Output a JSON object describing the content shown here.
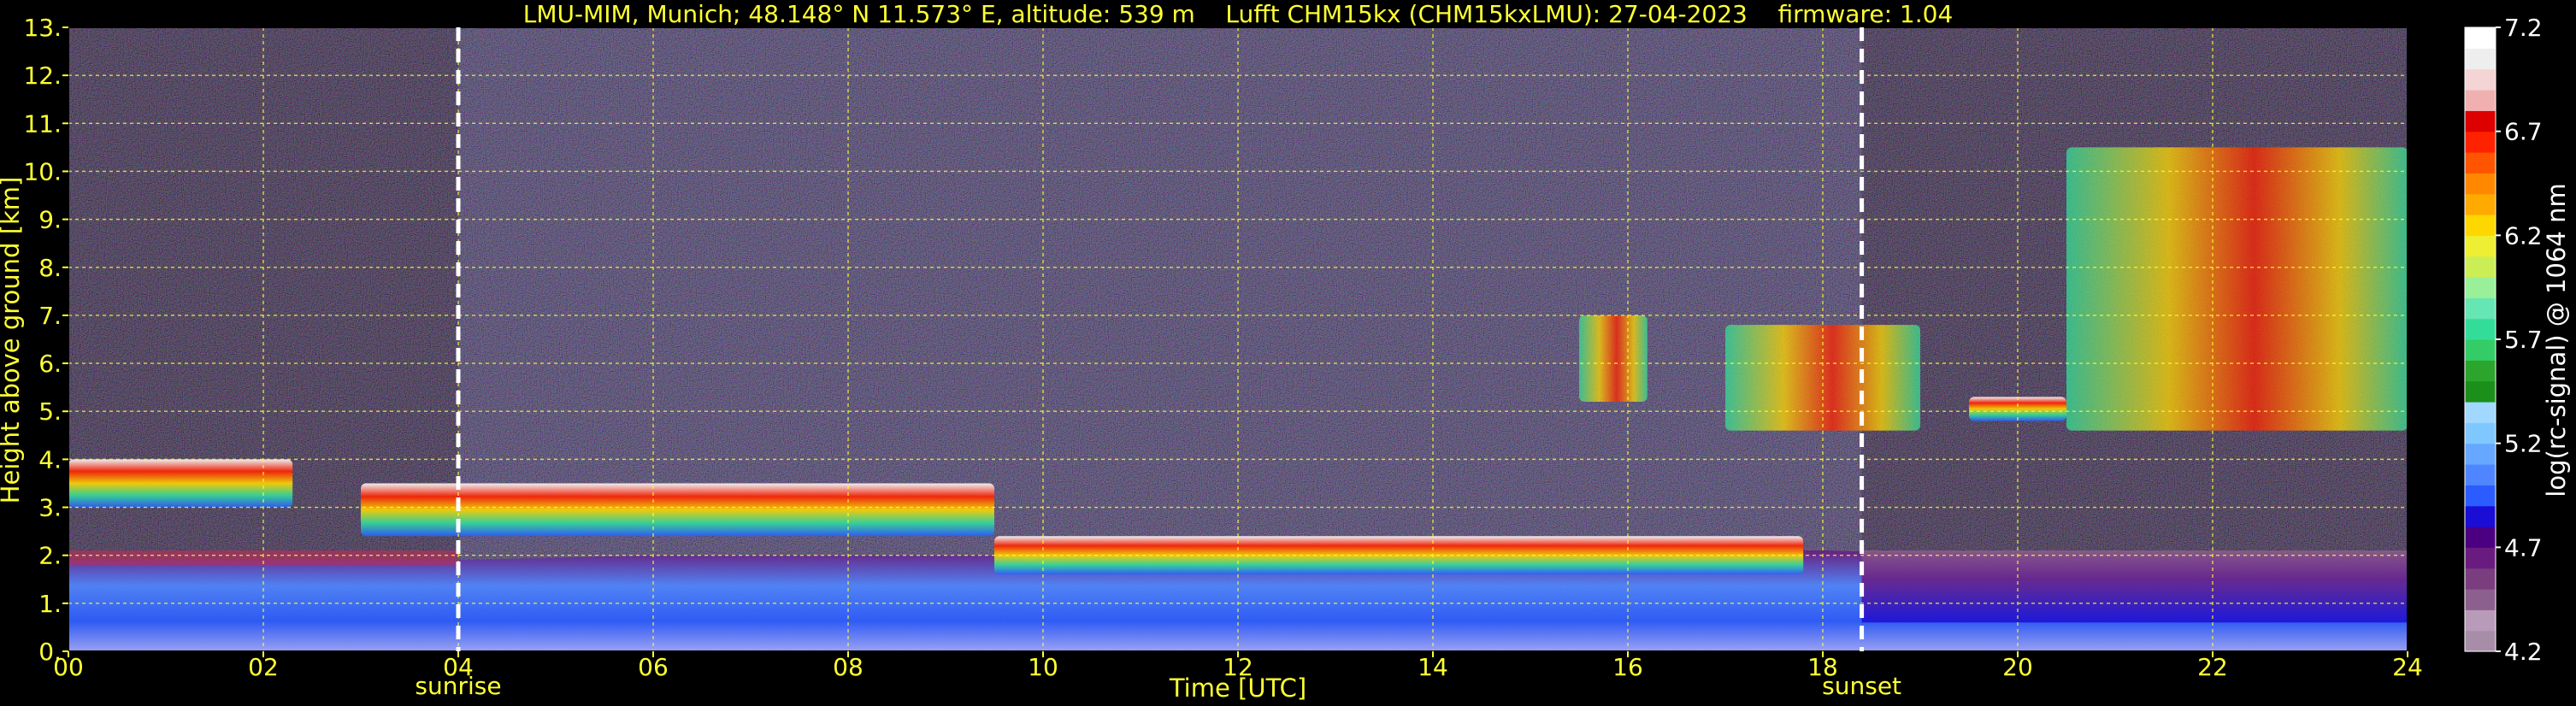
{
  "chart_data": {
    "type": "heatmap",
    "title": "LMU-MIM, Munich; 48.148° N 11.573° E, altitude: 539 m    Lufft CHM15kx (CHM15kxLMU): 27-04-2023    firmware: 1.04",
    "xlabel": "Time [UTC]",
    "ylabel": "Height above ground [km]",
    "xlim": [
      0,
      24
    ],
    "ylim": [
      0,
      13
    ],
    "x_ticks": [
      "00",
      "02",
      "04",
      "06",
      "08",
      "10",
      "12",
      "14",
      "16",
      "18",
      "20",
      "22",
      "24"
    ],
    "y_ticks": [
      "0.",
      "1.",
      "2.",
      "3.",
      "4.",
      "5.",
      "6.",
      "7.",
      "8.",
      "9.",
      "10.",
      "11.",
      "12.",
      "13."
    ],
    "grid": true,
    "colorbar": {
      "label": "log(rc-signal) @ 1064 nm",
      "range": [
        4.2,
        7.2
      ],
      "ticks": [
        "4.2",
        "4.7",
        "5.2",
        "5.7",
        "6.2",
        "6.7",
        "7.2"
      ],
      "colors": [
        "#a78da8",
        "#b89bb8",
        "#8d5f8f",
        "#7a3d7e",
        "#6a1b80",
        "#4b0082",
        "#1a0dd6",
        "#2b5cff",
        "#4f86ff",
        "#66a8ff",
        "#7fc8ff",
        "#a0d8ff",
        "#1a8f1a",
        "#2ba52b",
        "#33cc66",
        "#33dd99",
        "#66e6b3",
        "#99f099",
        "#ccee55",
        "#eeee33",
        "#ffd700",
        "#ffaa00",
        "#ff8800",
        "#ff5500",
        "#ff2200",
        "#dd0000",
        "#f0b0b0",
        "#f4d4d4",
        "#eeeeee",
        "#ffffff"
      ]
    },
    "events": [
      {
        "name": "sunrise",
        "time": 4.0
      },
      {
        "name": "sunset",
        "time": 18.4
      }
    ],
    "layers": {
      "boundary_layer": [
        [
          0,
          1.9
        ],
        [
          2,
          1.9
        ],
        [
          4,
          1.9
        ],
        [
          6,
          2.0
        ],
        [
          8,
          2.0
        ],
        [
          9.5,
          2.0
        ],
        [
          10,
          1.8
        ],
        [
          12,
          1.8
        ],
        [
          14,
          2.0
        ],
        [
          16,
          2.1
        ],
        [
          18,
          2.1
        ],
        [
          20,
          2.0
        ],
        [
          22,
          2.0
        ],
        [
          24,
          2.0
        ]
      ],
      "cloud_layers": [
        {
          "t": [
            0,
            2.3
          ],
          "h": [
            3.0,
            4.0
          ]
        },
        {
          "t": [
            3.0,
            9.5
          ],
          "h": [
            2.4,
            3.5
          ]
        },
        {
          "t": [
            9.5,
            17.8
          ],
          "h": [
            1.6,
            2.4
          ]
        },
        {
          "t": [
            15.5,
            16.2
          ],
          "h": [
            5.2,
            7.0
          ]
        },
        {
          "t": [
            17.0,
            19.0
          ],
          "h": [
            4.6,
            6.8
          ]
        },
        {
          "t": [
            19.5,
            20.5
          ],
          "h": [
            4.8,
            5.3
          ]
        },
        {
          "t": [
            20.5,
            24
          ],
          "h": [
            4.6,
            10.5
          ]
        }
      ]
    }
  }
}
